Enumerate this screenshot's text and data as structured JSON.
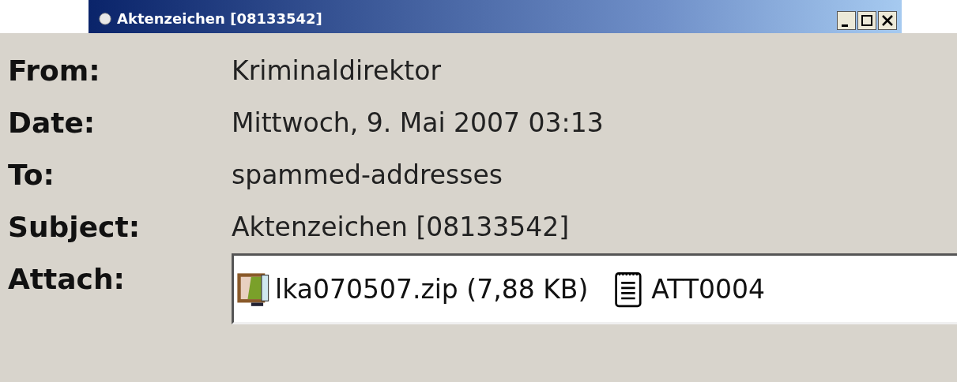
{
  "window": {
    "title": "Aktenzeichen [08133542]"
  },
  "headers": [
    {
      "label": "From:",
      "value": "Kriminaldirektor"
    },
    {
      "label": "Date:",
      "value": "Mittwoch, 9. Mai 2007 03:13"
    },
    {
      "label": "To:",
      "value": "spammed-addresses"
    },
    {
      "label": "Subject:",
      "value": "Aktenzeichen [08133542]"
    }
  ],
  "attach": {
    "label": "Attach:",
    "files": [
      {
        "kind": "zip",
        "name": "lka070507.zip (7,88 KB)"
      },
      {
        "kind": "text",
        "name": "ATT0004"
      }
    ]
  }
}
